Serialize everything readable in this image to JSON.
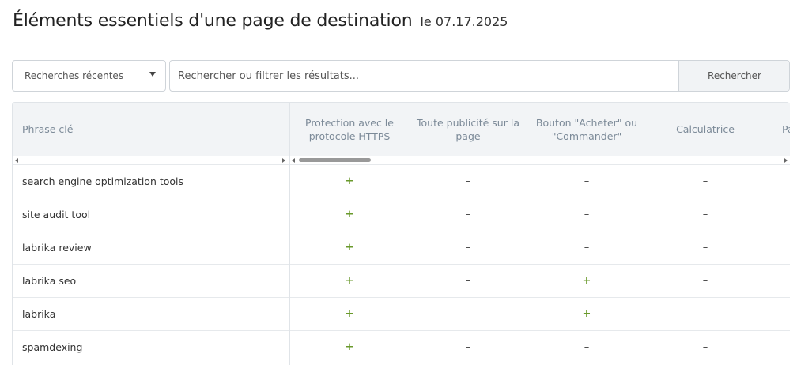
{
  "header": {
    "title": "Éléments essentiels d'une page de destination",
    "date": "le 07.17.2025"
  },
  "toolbar": {
    "recent_label": "Recherches récentes",
    "search_placeholder": "Rechercher ou filtrer les résultats...",
    "search_button": "Rechercher"
  },
  "table": {
    "columns": [
      "Phrase clé",
      "Protection avec le\nprotocole HTTPS",
      "Toute publicité sur la\npage",
      "Bouton \"Acheter\" ou\n\"Commander\"",
      "Calculatrice",
      "Pa"
    ],
    "rows": [
      {
        "keyword": "search engine optimization tools",
        "values": [
          "+",
          "–",
          "–",
          "–"
        ]
      },
      {
        "keyword": "site audit tool",
        "values": [
          "+",
          "–",
          "–",
          "–"
        ]
      },
      {
        "keyword": "labrika review",
        "values": [
          "+",
          "–",
          "–",
          "–"
        ]
      },
      {
        "keyword": "labrika seo",
        "values": [
          "+",
          "–",
          "+",
          "–"
        ]
      },
      {
        "keyword": "labrika",
        "values": [
          "+",
          "–",
          "+",
          "–"
        ]
      },
      {
        "keyword": "spamdexing",
        "values": [
          "+",
          "–",
          "–",
          "–"
        ]
      }
    ]
  },
  "colors": {
    "positive": "#6a9a2c",
    "header_bg": "#f2f4f6",
    "header_text": "#7c8a98"
  }
}
